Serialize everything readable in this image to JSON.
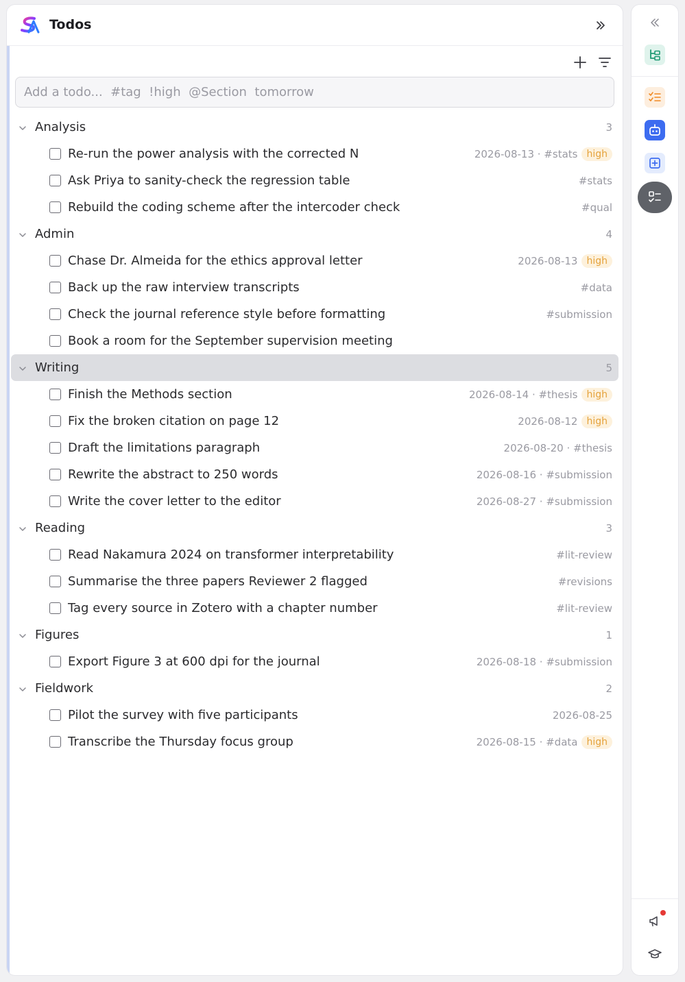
{
  "header": {
    "title": "Todos"
  },
  "add_input": {
    "placeholder": "Add a todo...  #tag  !high  @Section  tomorrow"
  },
  "sections": [
    {
      "name": "Analysis",
      "count": "3",
      "todos": [
        {
          "text": "Re-run the power analysis with the corrected N",
          "meta": "2026-08-13 · #stats",
          "priority": "high"
        },
        {
          "text": "Ask Priya to sanity-check the regression table",
          "meta": "#stats",
          "priority": ""
        },
        {
          "text": "Rebuild the coding scheme after the intercoder check",
          "meta": "#qual",
          "priority": ""
        }
      ]
    },
    {
      "name": "Admin",
      "count": "4",
      "todos": [
        {
          "text": "Chase Dr. Almeida for the ethics approval letter",
          "meta": "2026-08-13",
          "priority": "high"
        },
        {
          "text": "Back up the raw interview transcripts",
          "meta": "#data",
          "priority": ""
        },
        {
          "text": "Check the journal reference style before formatting",
          "meta": "#submission",
          "priority": ""
        },
        {
          "text": "Book a room for the September supervision meeting",
          "meta": "",
          "priority": ""
        }
      ]
    },
    {
      "name": "Writing",
      "count": "5",
      "selected": true,
      "todos": [
        {
          "text": "Finish the Methods section",
          "meta": "2026-08-14 · #thesis",
          "priority": "high"
        },
        {
          "text": "Fix the broken citation on page 12",
          "meta": "2026-08-12",
          "priority": "high"
        },
        {
          "text": "Draft the limitations paragraph",
          "meta": "2026-08-20 · #thesis",
          "priority": ""
        },
        {
          "text": "Rewrite the abstract to 250 words",
          "meta": "2026-08-16 · #submission",
          "priority": ""
        },
        {
          "text": "Write the cover letter to the editor",
          "meta": "2026-08-27 · #submission",
          "priority": ""
        }
      ]
    },
    {
      "name": "Reading",
      "count": "3",
      "todos": [
        {
          "text": "Read Nakamura 2024 on transformer interpretability",
          "meta": "#lit-review",
          "priority": ""
        },
        {
          "text": "Summarise the three papers Reviewer 2 flagged",
          "meta": "#revisions",
          "priority": ""
        },
        {
          "text": "Tag every source in Zotero with a chapter number",
          "meta": "#lit-review",
          "priority": ""
        }
      ]
    },
    {
      "name": "Figures",
      "count": "1",
      "todos": [
        {
          "text": "Export Figure 3 at 600 dpi for the journal",
          "meta": "2026-08-18 · #submission",
          "priority": ""
        }
      ]
    },
    {
      "name": "Fieldwork",
      "count": "2",
      "todos": [
        {
          "text": "Pilot the survey with five participants",
          "meta": "2026-08-25",
          "priority": ""
        },
        {
          "text": "Transcribe the Thursday focus group",
          "meta": "2026-08-15 · #data",
          "priority": "high"
        }
      ]
    }
  ],
  "rail": {
    "icons": [
      "collapse-left-icon",
      "tree-view-icon",
      "checklist-icon",
      "robot-icon",
      "add-box-icon",
      "todo-list-icon",
      "announcement-icon",
      "graduation-cap-icon"
    ]
  },
  "colors": {
    "accent_bar": "#c9d4f3",
    "high_badge_bg": "#fdf1dc",
    "high_badge_text": "#e5a23b",
    "selected_section_bg": "#dcdde1",
    "notification_dot": "#e53935"
  }
}
